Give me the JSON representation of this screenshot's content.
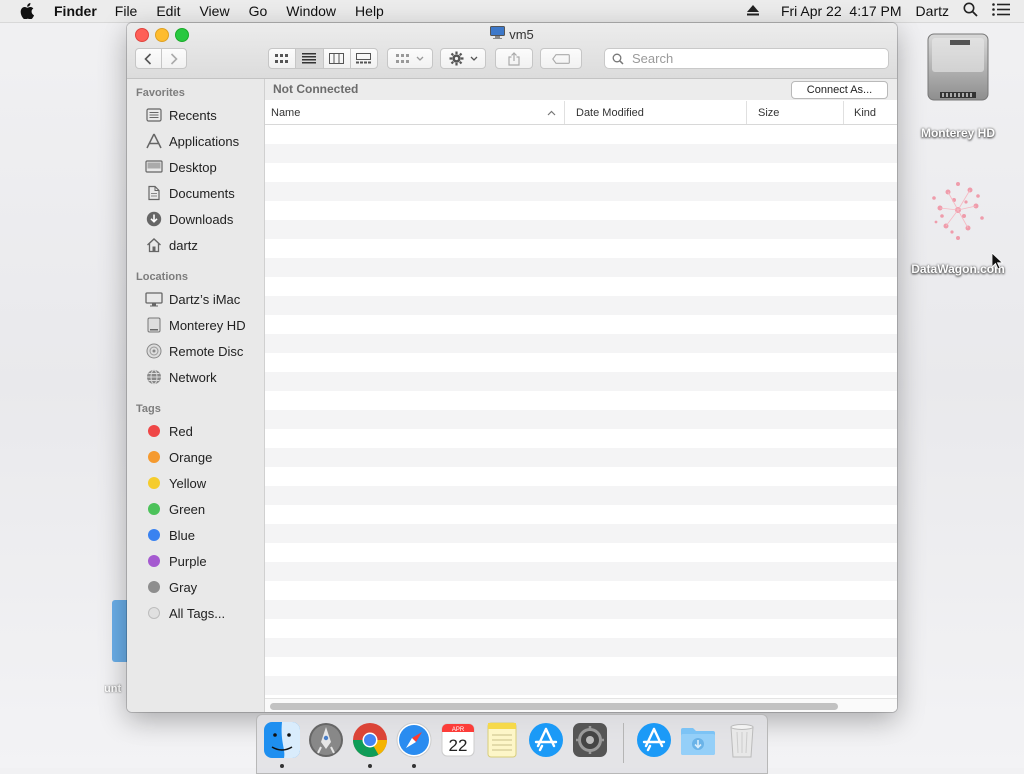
{
  "menubar": {
    "app_name": "Finder",
    "menus": [
      "File",
      "Edit",
      "View",
      "Go",
      "Window",
      "Help"
    ],
    "clock": "Fri Apr 22  4:17 PM",
    "user": "Dartz"
  },
  "desktop": {
    "icons": [
      {
        "label": "Monterey HD",
        "icon": "hard-drive-icon"
      },
      {
        "label": "DataWagon.com",
        "icon": "datawagon-image-icon"
      }
    ],
    "partial_icon_label": "unt"
  },
  "window": {
    "title": "vm5",
    "toolbar": {
      "search_placeholder": "Search",
      "view_modes": [
        "icon-view",
        "list-view",
        "column-view",
        "gallery-view"
      ],
      "active_view": "list-view"
    },
    "sidebar": {
      "favorites_header": "Favorites",
      "favorites": [
        {
          "label": "Recents",
          "icon": "recents-icon"
        },
        {
          "label": "Applications",
          "icon": "applications-icon"
        },
        {
          "label": "Desktop",
          "icon": "desktop-icon"
        },
        {
          "label": "Documents",
          "icon": "documents-icon"
        },
        {
          "label": "Downloads",
          "icon": "downloads-icon"
        },
        {
          "label": "dartz",
          "icon": "home-icon"
        }
      ],
      "locations_header": "Locations",
      "locations": [
        {
          "label": "Dartz’s iMac",
          "icon": "imac-icon"
        },
        {
          "label": "Monterey HD",
          "icon": "hard-drive-icon"
        },
        {
          "label": "Remote Disc",
          "icon": "remote-disc-icon"
        },
        {
          "label": "Network",
          "icon": "network-icon"
        }
      ],
      "tags_header": "Tags",
      "tags": [
        {
          "label": "Red",
          "color": "#ef4747"
        },
        {
          "label": "Orange",
          "color": "#f59a2f"
        },
        {
          "label": "Yellow",
          "color": "#f5cc2c"
        },
        {
          "label": "Green",
          "color": "#4cc25a"
        },
        {
          "label": "Blue",
          "color": "#3a82f0"
        },
        {
          "label": "Purple",
          "color": "#a55ad0"
        },
        {
          "label": "Gray",
          "color": "#8e8e8e"
        },
        {
          "label": "All Tags...",
          "color": "#e0e0e0"
        }
      ]
    },
    "content": {
      "status": "Not Connected",
      "connect_button": "Connect As...",
      "columns": [
        "Name",
        "Date Modified",
        "Size",
        "Kind"
      ],
      "sort_column": "Name",
      "sort_direction": "ascending"
    }
  },
  "dock": {
    "apps": [
      {
        "name": "Finder",
        "icon": "finder-icon",
        "running": true
      },
      {
        "name": "Launchpad",
        "icon": "launchpad-icon",
        "running": false
      },
      {
        "name": "Google Chrome",
        "icon": "chrome-icon",
        "running": true
      },
      {
        "name": "Safari",
        "icon": "safari-icon",
        "running": true
      },
      {
        "name": "Calendar",
        "icon": "calendar-icon",
        "running": false,
        "month": "APR",
        "day": "22"
      },
      {
        "name": "Notes",
        "icon": "notes-icon",
        "running": false
      },
      {
        "name": "App Store",
        "icon": "app-store-icon",
        "running": false
      },
      {
        "name": "System Preferences",
        "icon": "system-preferences-icon",
        "running": false
      },
      {
        "name": "App Store",
        "icon": "app-store-icon",
        "running": false
      },
      {
        "name": "Downloads",
        "icon": "downloads-folder-icon",
        "running": false
      },
      {
        "name": "Trash",
        "icon": "trash-icon",
        "running": false
      }
    ]
  }
}
